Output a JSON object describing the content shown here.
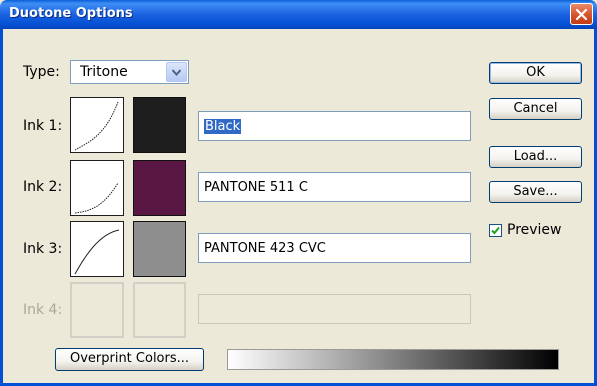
{
  "window": {
    "title": "Duotone Options"
  },
  "type": {
    "label": "Type:",
    "value": "Tritone"
  },
  "inks": [
    {
      "label": "Ink 1:",
      "name": "Black",
      "swatch": "#1E1E1E",
      "enabled": true,
      "selected": true
    },
    {
      "label": "Ink 2:",
      "name": "PANTONE 511 C",
      "swatch": "#5A1744",
      "enabled": true,
      "selected": false
    },
    {
      "label": "Ink 3:",
      "name": "PANTONE 423 CVC",
      "swatch": "#8E8E8E",
      "enabled": true,
      "selected": false
    },
    {
      "label": "Ink 4:",
      "name": "",
      "swatch": "#ECE9D8",
      "enabled": false,
      "selected": false
    }
  ],
  "buttons": {
    "ok": "OK",
    "cancel": "Cancel",
    "load": "Load...",
    "save": "Save...",
    "overprint": "Overprint Colors..."
  },
  "preview": {
    "label": "Preview",
    "checked": true
  },
  "colors": {
    "title_bar": "#0450D4",
    "close_button": "#D5532C",
    "dialog_bg": "#ECE9D8",
    "selection": "#316AC5"
  }
}
